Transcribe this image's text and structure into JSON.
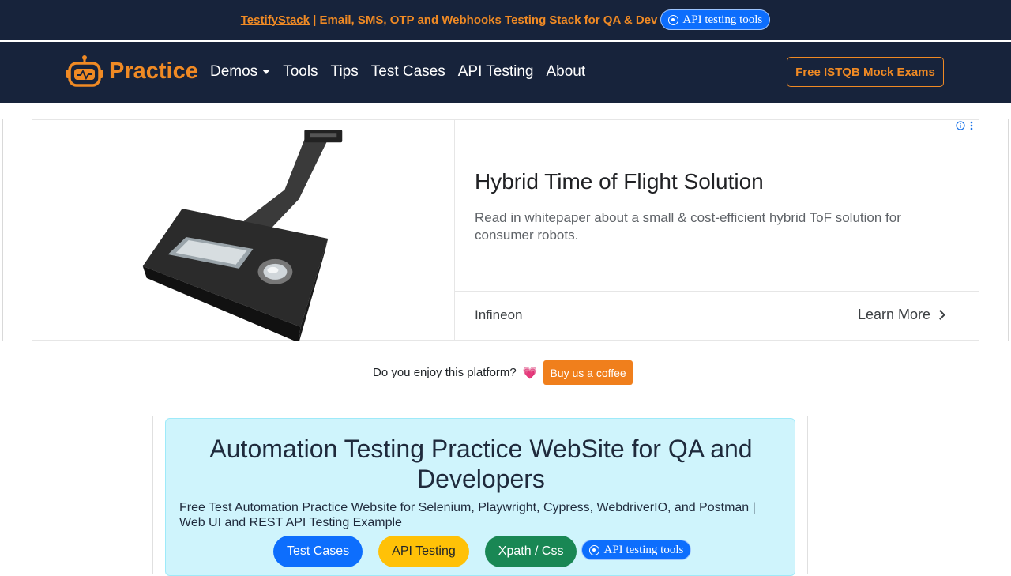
{
  "promo": {
    "brand": "TestifyStack",
    "text": " | Email, SMS, OTP and Webhooks Testing Stack for QA & Dev",
    "api_button": "API testing tools"
  },
  "nav": {
    "logo": "Practice",
    "items": [
      {
        "label": "Demos",
        "dropdown": true
      },
      {
        "label": "Tools"
      },
      {
        "label": "Tips"
      },
      {
        "label": "Test Cases"
      },
      {
        "label": "API Testing"
      },
      {
        "label": "About"
      }
    ],
    "cta": "Free ISTQB Mock Exams"
  },
  "ad": {
    "title": "Hybrid Time of Flight Solution",
    "description": "Read in whitepaper about a small & cost-efficient hybrid ToF solution for consumer robots.",
    "advertiser": "Infineon",
    "cta": "Learn More"
  },
  "support": {
    "text": "Do you enjoy this platform?",
    "heart": "💗",
    "button": "Buy us a coffee"
  },
  "hero": {
    "title": "Automation Testing Practice WebSite for QA and Developers",
    "subtitle": "Free Test Automation Practice Website for Selenium, Playwright, Cypress, WebdriverIO, and Postman | Web UI and REST API Testing Example",
    "buttons": [
      "Test Cases",
      "API Testing",
      "Xpath / Css"
    ],
    "api_button": "API testing tools"
  },
  "colors": {
    "navy": "#17233b",
    "orange": "#f08a24",
    "hero_bg": "#cff4fc",
    "blue": "#0d6efd",
    "yellow": "#ffc107",
    "green": "#198754"
  }
}
